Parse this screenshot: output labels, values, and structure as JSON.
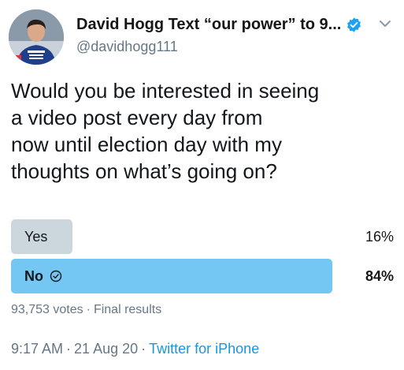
{
  "colors": {
    "accent": "#1b95e0",
    "verified": "#1da1f2",
    "winning_bar": "#74c6f3",
    "losing_bar": "#ccd6dd",
    "secondary_text": "#657786",
    "primary_text": "#14171a"
  },
  "author": {
    "display_name": "David Hogg Text “our power” to 9...",
    "handle": "@davidhogg111",
    "avatar_icon": "avatar-icon",
    "verified_icon": "verified-badge-icon",
    "menu_icon": "chevron-down-icon"
  },
  "tweet": {
    "lines": [
      "Would you be interested in seeing",
      "a video post every day from",
      "now until election day with my",
      "thoughts on what’s going on?"
    ]
  },
  "poll": {
    "options": [
      {
        "label": "Yes",
        "percent_text": "16%",
        "percent": 16,
        "winner": false
      },
      {
        "label": "No",
        "percent_text": "84%",
        "percent": 84,
        "winner": true,
        "icon": "check-circle-icon"
      }
    ],
    "votes": "93,753 votes",
    "separator": "·",
    "status": "Final results"
  },
  "meta": {
    "time": "9:17 AM",
    "separator": "·",
    "date": "21 Aug 20",
    "source": "Twitter for iPhone"
  }
}
